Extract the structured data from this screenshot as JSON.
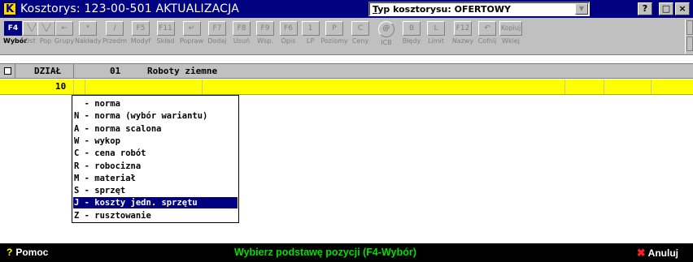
{
  "window": {
    "app_icon": "K",
    "title": "Kosztorys: 123-00-501 AKTUALIZACJA",
    "type_prefix": "T",
    "type_rest": "yp kosztorysu: OFERTOWY",
    "buttons": [
      "?",
      "□",
      "×"
    ]
  },
  "toolbar": {
    "items": [
      {
        "key": "F4",
        "label": "Wybór",
        "icon": "f4-key-icon"
      },
      {
        "key": "╲╱",
        "label": "Ost",
        "icon": "triangle-down-icon"
      },
      {
        "key": "╲╱",
        "label": "Pop",
        "icon": "triangle-down-icon"
      },
      {
        "key": "←",
        "label": "Grupy",
        "icon": "arrow-left-icon"
      },
      {
        "key": "*",
        "label": "Nakłady",
        "icon": "asterisk-icon"
      },
      {
        "key": "/",
        "label": "Przedm",
        "icon": "slash-icon"
      },
      {
        "key": "F5",
        "label": "Modyf",
        "icon": "f5-key-icon"
      },
      {
        "key": "F11",
        "label": "Skład",
        "icon": "f11-key-icon"
      },
      {
        "key": "↵",
        "label": "Popraw",
        "icon": "enter-icon"
      },
      {
        "key": "F7",
        "label": "Dodaj",
        "icon": "f7-key-icon"
      },
      {
        "key": "F8",
        "label": "Usuń",
        "icon": "f8-key-icon"
      },
      {
        "key": "F9",
        "label": "Wsp.",
        "icon": "f9-key-icon"
      },
      {
        "key": "F6",
        "label": "Opis",
        "icon": "f6-key-icon"
      },
      {
        "key": "1",
        "label": "LP",
        "icon": "one-key-icon"
      },
      {
        "key": "P",
        "label": "Poziomy",
        "icon": "p-key-icon"
      },
      {
        "key": "C",
        "label": "Ceny",
        "icon": "c-key-icon"
      },
      {
        "key": "@",
        "label": "ICB",
        "icon": "icb-icon"
      },
      {
        "key": "B",
        "label": "Błędy",
        "icon": "b-key-icon"
      },
      {
        "key": "L",
        "label": "Limit",
        "icon": "l-key-icon"
      },
      {
        "key": "F12",
        "label": "Nazwy",
        "icon": "f12-key-icon"
      },
      {
        "key": "↶",
        "label": "Cofnij",
        "icon": "undo-icon"
      },
      {
        "key": "Kopiuj",
        "label": "Wklej",
        "icon": "copy-paste-icon"
      }
    ]
  },
  "header": {
    "col1": "DZIAŁ",
    "col2": "01",
    "col3": "Roboty ziemne"
  },
  "current_row": {
    "number": "10"
  },
  "dropdown": {
    "items": [
      "  - norma",
      "N - norma (wybór wariantu)",
      "A - norma scalona",
      "W - wykop",
      "C - cena robót",
      "R - robocizna",
      "M - materiał",
      "S - sprzęt",
      "J - koszty jedn. sprzętu",
      "Z - rusztowanie"
    ],
    "selected_index": 8
  },
  "status": {
    "help_icon": "?",
    "help": "Pomoc",
    "hint": "Wybierz podstawę pozycji (F4-Wybór)",
    "cancel_icon": "✖",
    "cancel": "Anuluj"
  }
}
